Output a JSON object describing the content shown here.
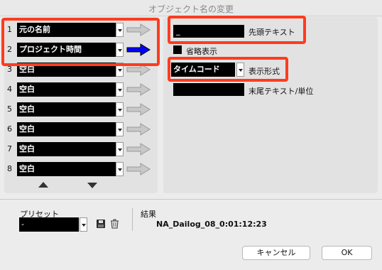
{
  "window": {
    "title": "オブジェクト名の変更"
  },
  "rows": [
    {
      "num": "1",
      "value": "元の名前",
      "arrow": "gray"
    },
    {
      "num": "2",
      "value": "プロジェクト時間",
      "arrow": "blue"
    },
    {
      "num": "3",
      "value": "空白",
      "arrow": "gray"
    },
    {
      "num": "4",
      "value": "空白",
      "arrow": "gray"
    },
    {
      "num": "5",
      "value": "空白",
      "arrow": "gray"
    },
    {
      "num": "6",
      "value": "空白",
      "arrow": "gray"
    },
    {
      "num": "7",
      "value": "空白",
      "arrow": "gray"
    },
    {
      "num": "8",
      "value": "空白",
      "arrow": "gray"
    }
  ],
  "right": {
    "prefix_value": "_",
    "prefix_label": "先頭テキスト",
    "abbrev_label": "省略表示",
    "format_value": "タイムコード",
    "format_label": "表示形式",
    "suffix_value": "",
    "suffix_label": "末尾テキスト/単位"
  },
  "preset": {
    "label": "プリセット",
    "value": "-"
  },
  "result": {
    "label": "結果",
    "value": "NA_Dailog_08_0:01:12:23"
  },
  "buttons": {
    "cancel": "キャンセル",
    "ok": "OK"
  },
  "colors": {
    "highlight": "#ff3b1f",
    "arrow_active": "#0000ff",
    "arrow_inactive": "#c8c8c8"
  }
}
